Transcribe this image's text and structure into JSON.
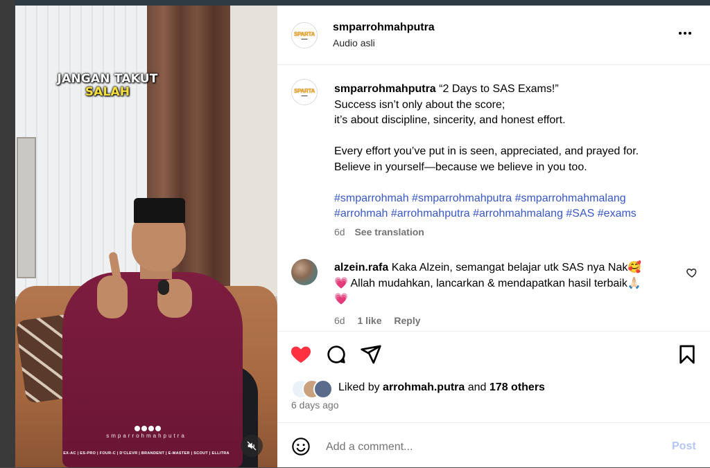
{
  "media": {
    "overlay_line1": "JANGAN TAKUT",
    "overlay_line2": "SALAH",
    "watermark": "smparrohmahputra",
    "programs": "EX-AC | ES-PRO | FOUR-C | D'CLEVR | BRANDENT | E-MASTER | SCOUT | ELLITRA"
  },
  "header": {
    "avatar_logo": "SPARTA",
    "username": "smparrohmahputra",
    "audio": "Audio asli"
  },
  "caption": {
    "username": "smparrohmahputra",
    "line1": "“2 Days to SAS Exams!”",
    "line2": "Success isn’t only about the score;",
    "line3": "it’s about discipline, sincerity, and honest effort.",
    "line4": "Every effort you’ve put in is seen, appreciated, and prayed for.",
    "line5": "Believe in yourself—because we believe in you too.",
    "hashtags1": "#smparrohmah #smparrohmahputra #smparrohmahmalang",
    "hashtags2": "#arrohmah #arrohmahputra #arrohmahmalang #SAS #exams",
    "age": "6d",
    "see_translation": "See translation"
  },
  "comment": {
    "username": "alzein.rafa",
    "text1": "Kaka Alzein, semangat belajar utk SAS nya Nak",
    "emoji1": "🥰",
    "heart1": "💗",
    "text2": "Allah mudahkan, lancarkan & mendapatkan hasil terbaik",
    "emoji2": "🙏🏻",
    "heart2": "💗",
    "age": "6d",
    "likes": "1 like",
    "reply": "Reply"
  },
  "likes": {
    "prefix": "Liked by",
    "user": "arrohmah.putra",
    "and": "and",
    "others": "178 others"
  },
  "post_age": "6 days ago",
  "add_comment": {
    "placeholder": "Add a comment...",
    "post_label": "Post"
  },
  "colors": {
    "like_red": "#ff3040",
    "hashtag_blue": "#3757c8",
    "post_disabled": "#b3c7f7"
  }
}
